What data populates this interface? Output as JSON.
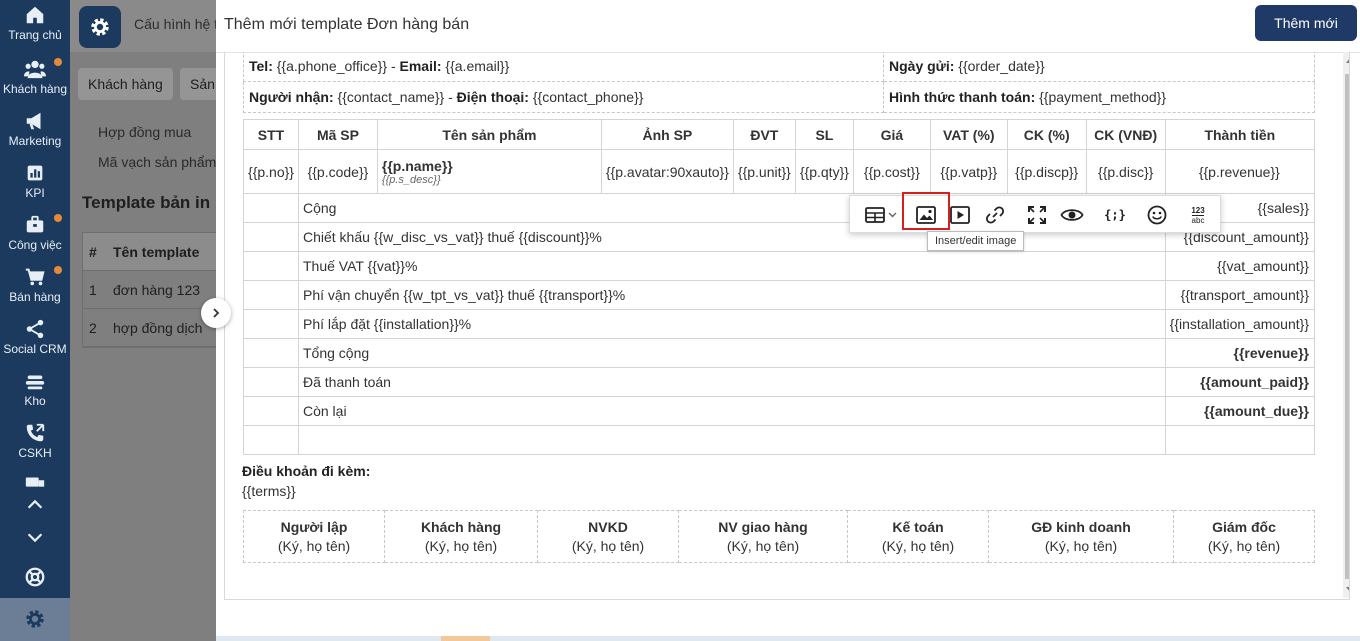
{
  "nav": {
    "items": [
      {
        "label": "Trang chủ",
        "icon": "home-icon",
        "dot": false
      },
      {
        "label": "Khách hàng",
        "icon": "users-icon",
        "dot": true
      },
      {
        "label": "Marketing",
        "icon": "megaphone-icon",
        "dot": false
      },
      {
        "label": "KPI",
        "icon": "bar-chart-icon",
        "dot": false
      },
      {
        "label": "Công việc",
        "icon": "briefcase-icon",
        "dot": true
      },
      {
        "label": "Bán hàng",
        "icon": "cart-icon",
        "dot": true
      },
      {
        "label": "Social CRM",
        "icon": "share-icon",
        "dot": false
      },
      {
        "label": "Kho",
        "icon": "warehouse-icon",
        "dot": false
      },
      {
        "label": "CSKH",
        "icon": "phone-icon",
        "dot": false
      }
    ]
  },
  "bg": {
    "title": "Cấu hình hệ t",
    "tabs": [
      "Khách hàng",
      "Sản"
    ],
    "links": [
      "Hợp đồng mua",
      "Mã vạch sản phẩm"
    ],
    "heading": "Template bản in",
    "table_header": [
      "#",
      "Tên template"
    ],
    "rows": [
      {
        "no": "1",
        "name": "đơn hàng 123"
      },
      {
        "no": "2",
        "name": "hợp đồng dịch"
      }
    ]
  },
  "modal": {
    "title": "Thêm mới template Đơn hàng bán",
    "add_button": "Thêm mới"
  },
  "info": {
    "tel_label": "Tel:",
    "tel_value": "{{a.phone_office}}",
    "email_label": "Email:",
    "email_value": "{{a.email}}",
    "date_label": "Ngày gửi:",
    "date_value": "{{order_date}}",
    "recipient_label": "Người nhận:",
    "recipient_value": "{{contact_name}}",
    "phone_label": "Điện thoại:",
    "phone_value": "{{contact_phone}}",
    "payment_label": "Hình thức thanh toán:",
    "payment_value": "{{payment_method}}",
    "sep": " - "
  },
  "products": {
    "headers": [
      "STT",
      "Mã SP",
      "Tên sản phẩm",
      "Ảnh SP",
      "ĐVT",
      "SL",
      "Giá",
      "VAT (%)",
      "CK (%)",
      "CK (VNĐ)",
      "Thành tiền"
    ],
    "row": {
      "no": "{{p.no}}",
      "code": "{{p.code}}",
      "name": "{{p.name}}",
      "desc": "{{p.s_desc}}",
      "avatar": "{{p.avatar:90xauto}}",
      "unit": "{{p.unit}}",
      "qty": "{{p.qty}}",
      "cost": "{{p.cost}}",
      "vatp": "{{p.vatp}}",
      "discp": "{{p.discp}}",
      "disc": "{{p.disc}}",
      "revenue": "{{p.revenue}}"
    },
    "summary": [
      {
        "label": "Cộng",
        "value": "{{sales}}",
        "bold": false
      },
      {
        "label": "Chiết khấu {{w_disc_vs_vat}} thuế {{discount}}%",
        "value": "{{discount_amount}}",
        "bold": false
      },
      {
        "label": "Thuế VAT {{vat}}%",
        "value": "{{vat_amount}}",
        "bold": false
      },
      {
        "label": "Phí vận chuyển {{w_tpt_vs_vat}} thuế {{transport}}%",
        "value": "{{transport_amount}}",
        "bold": false
      },
      {
        "label": "Phí lắp đặt {{installation}}%",
        "value": "{{installation_amount}}",
        "bold": false
      },
      {
        "label": "Tổng cộng",
        "value": "{{revenue}}",
        "bold": true
      },
      {
        "label": "Đã thanh toán",
        "value": "{{amount_paid}}",
        "bold": true
      },
      {
        "label": "Còn lại",
        "value": "{{amount_due}}",
        "bold": true
      }
    ]
  },
  "terms": {
    "label": "Điều khoản đi kèm:",
    "value": "{{terms}}"
  },
  "signatures": [
    {
      "title": "Người lập",
      "note": "(Ký, họ tên)"
    },
    {
      "title": "Khách hàng",
      "note": "(Ký, họ tên)"
    },
    {
      "title": "NVKD",
      "note": "(Ký, họ tên)"
    },
    {
      "title": "NV giao hàng",
      "note": "(Ký, họ tên)"
    },
    {
      "title": "Kế toán",
      "note": "(Ký, họ tên)"
    },
    {
      "title": "GĐ kinh doanh",
      "note": "(Ký, họ tên)"
    },
    {
      "title": "Giám đốc",
      "note": "(Ký, họ tên)"
    }
  ],
  "toolbar": {
    "tooltip": "Insert/edit image",
    "buttons": [
      "table-icon",
      "image-icon",
      "media-icon",
      "link-icon",
      "fullscreen-icon",
      "preview-icon",
      "code-sample-icon",
      "emoticon-icon",
      "word-count-icon"
    ],
    "wordcount_top": "123",
    "wordcount_bottom": "abc",
    "code_glyph": "{;}"
  },
  "colors": {
    "nav_bg": "#1c3a5e",
    "primary_button": "#1f3a67",
    "highlight": "#d21f1f",
    "badge": "#e58a3a"
  }
}
